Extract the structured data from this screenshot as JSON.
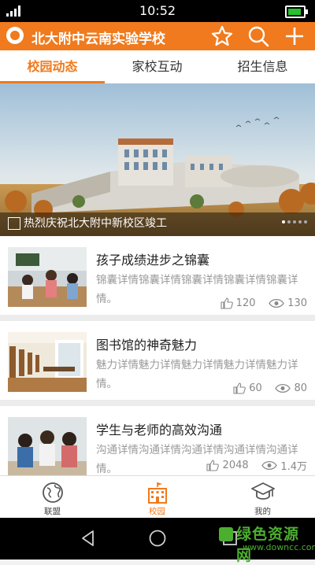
{
  "status_bar": {
    "time": "10:52"
  },
  "app_bar": {
    "title": "北大附中云南实验学校"
  },
  "tabs": [
    {
      "label": "校园动态",
      "active": true
    },
    {
      "label": "家校互动",
      "active": false
    },
    {
      "label": "招生信息",
      "active": false
    }
  ],
  "banner": {
    "caption": "热烈庆祝北大附中新校区竣工"
  },
  "articles": [
    {
      "title": "孩子成绩进步之锦囊",
      "description": "锦囊详情锦囊详情锦囊详情锦囊详情锦囊详情。",
      "likes": "120",
      "views": "130"
    },
    {
      "title": "图书馆的神奇魅力",
      "description": "魅力详情魅力详情魅力详情魅力详情魅力详情。",
      "likes": "60",
      "views": "80"
    },
    {
      "title": "学生与老师的高效沟通",
      "description": "沟通详情沟通详情沟通详情沟通详情沟通详情。",
      "likes": "2048",
      "views": "1.4万"
    }
  ],
  "bottom_nav": [
    {
      "label": "联盟",
      "icon": "globe-icon",
      "active": false
    },
    {
      "label": "校园",
      "icon": "school-building-icon",
      "active": true
    },
    {
      "label": "我的",
      "icon": "graduation-cap-icon",
      "active": false
    }
  ],
  "watermark": {
    "title": "绿色资源网",
    "url": "www.downcc.com"
  },
  "colors": {
    "accent": "#f07a1d",
    "status_bar": "#000000",
    "divider": "#ececec"
  }
}
